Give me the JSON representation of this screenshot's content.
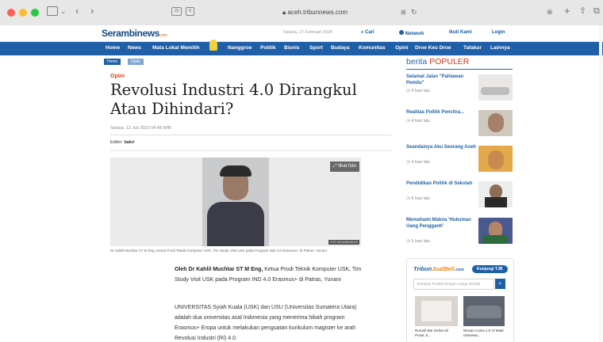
{
  "browser": {
    "url": "aceh.tribunnews.com",
    "colors": {
      "close": "#fe5f57",
      "min": "#febc2e",
      "max": "#28c840"
    }
  },
  "header": {
    "logo": "Serambinews",
    "logo_suffix": ".com",
    "date": "Selasa, 27 Februari 2024",
    "search": "Cari",
    "network": "Network",
    "ikuti": "Ikuti Kami",
    "login": "Login"
  },
  "nav": {
    "items": [
      "Home",
      "News",
      "Mata Lokal Memilih",
      "Nanggroe",
      "Politik",
      "Bisnis",
      "Sport",
      "Budaya",
      "Komunitas",
      "Opini",
      "Droe Keu Droe",
      "Tafakur",
      "Lainnya"
    ]
  },
  "breadcrumb": {
    "home": "Home",
    "current": "Opini"
  },
  "article": {
    "category": "Opini",
    "title": "Revolusi Industri 4.0 Dirangkul Atau Dihindari?",
    "date": "Selasa, 12 Juli 2022 04:48 WIB",
    "editor_label": "Editor:",
    "editor": "bakri",
    "lihat_foto": "lihat foto",
    "photo_credit": "FOR SERAMBINEWS",
    "caption": "Dr Kahlil Muchtar ST M Eng, Ketua Prodi Teknik Komputer USK, Tim Study Visit USK pada Program IND 4.0 Erasmus+ di Patras, Yunani",
    "author_name": "Oleh Dr Kahlil Muchtar ST M Eng,",
    "author_desc": "Ketua Prodi Teknik Komputer USK, Tim Study Visit USK pada Program IND 4.0 Erasmus+ di Patras, Yunani",
    "para1": "UNIVERSITAS Syiah Kuala (USK) dan USU (Universitas Sumatera Utara) adalah dua universitas asal Indonesia yang menerima hibah program Erasmus+ Eropa untuk melakukan penguatan kurikulum magister ke arah Revolusi Industri (RI) 4.0."
  },
  "populer": {
    "heading_a": "berita",
    "heading_b": "POPULER",
    "items": [
      {
        "title": "Selamat Jalan \"Pahlawan Pemilu\"",
        "time": "4 hari lalu"
      },
      {
        "title": "Realitas Politik Pencitra...",
        "time": "4 hari lalu"
      },
      {
        "title": "Seandainya Aku Seorang Aceh",
        "time": "4 hari lalu"
      },
      {
        "title": "Pendidikan Politik di Sekolah",
        "time": "5 hari lalu"
      },
      {
        "title": "Memahami Makna 'Hukuman Uang Pengganti'",
        "time": "5 hari lalu"
      }
    ]
  },
  "jualbeli": {
    "logo_a": "Tribun",
    "logo_b": "JualBeli",
    "logo_c": ".com",
    "kunjungi": "Kunjungi TJB",
    "search_placeholder": "Temukan Produk Dengan Harga Terbaik",
    "products": [
      {
        "title": "Rumah Bar Dekat Uii Pusat Ji..."
      },
      {
        "title": "Nissan Livina 1.5 Vl Matic Istimewa..."
      }
    ]
  }
}
